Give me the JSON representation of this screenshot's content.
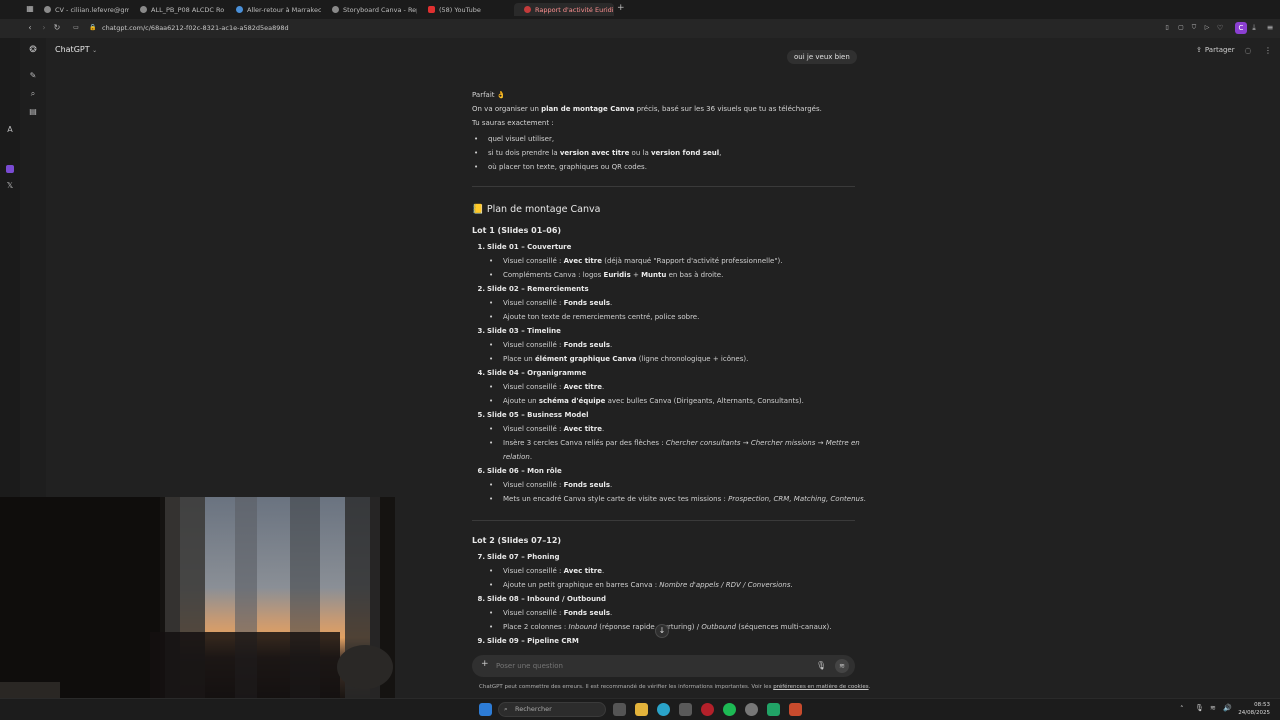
{
  "browser": {
    "tabs": [
      {
        "label": "CV - ciliian.lefevre@gm"
      },
      {
        "label": "ALL_PB_P08 ALCDC Ro"
      },
      {
        "label": "Aller-retour à Marrakech"
      },
      {
        "label": "Storyboard Canva - Rep"
      },
      {
        "label": "(58) YouTube"
      },
      {
        "label": "Rapport d'activité Euridis"
      }
    ],
    "new_tab": "+",
    "url": "chatgpt.com/c/68aa6212-f02c-8321-ac1e-a582d5ea898d"
  },
  "header": {
    "app_title": "ChatGPT",
    "share_label": "Partager"
  },
  "user_message": "oui je veux bien",
  "intro": {
    "parfait": "Parfait 👌",
    "line1_a": "On va organiser un ",
    "line1_b": "plan de montage Canva",
    "line1_c": " précis, basé sur les 36 visuels que tu as téléchargés.",
    "line2": "Tu sauras exactement :",
    "bullets": [
      {
        "a": "quel visuel utiliser,",
        "b": "",
        "c": "",
        "d": "",
        "e": ""
      },
      {
        "a": "si tu dois prendre la ",
        "b": "version avec titre",
        "c": " ou la ",
        "d": "version fond seul",
        "e": ","
      },
      {
        "a": "où placer ton texte, graphiques ou QR codes.",
        "b": "",
        "c": "",
        "d": "",
        "e": ""
      }
    ]
  },
  "plan_title": "📒 Plan de montage Canva",
  "lot1": {
    "title": "Lot 1 (Slides 01–06)",
    "slides": [
      {
        "num": "1.",
        "title": "Slide 01 – Couverture"
      },
      {
        "num": "2.",
        "title": "Slide 02 – Remerciements"
      },
      {
        "num": "3.",
        "title": "Slide 03 – Timeline"
      },
      {
        "num": "4.",
        "title": "Slide 04 – Organigramme"
      },
      {
        "num": "5.",
        "title": "Slide 05 – Business Model"
      },
      {
        "num": "6.",
        "title": "Slide 06 – Mon rôle"
      }
    ],
    "bullets": {
      "s1a_pre": "Visuel conseillé : ",
      "s1a_b": "Avec titre",
      "s1a_post": " (déjà marqué \"Rapport d'activité professionnelle\").",
      "s1b_pre": "Compléments Canva : logos ",
      "s1b_b1": "Euridis",
      "s1b_mid": " + ",
      "s1b_b2": "Muntu",
      "s1b_post": " en bas à droite.",
      "s2a_pre": "Visuel conseillé : ",
      "s2a_b": "Fonds seuls",
      "s2a_post": ".",
      "s2b": "Ajoute ton texte de remerciements centré, police sobre.",
      "s3a_pre": "Visuel conseillé : ",
      "s3a_b": "Fonds seuls",
      "s3a_post": ".",
      "s3b_pre": "Place un ",
      "s3b_b": "élément graphique Canva",
      "s3b_post": " (ligne chronologique + icônes).",
      "s4a_pre": "Visuel conseillé : ",
      "s4a_b": "Avec titre",
      "s4a_post": ".",
      "s4b_pre": "Ajoute un ",
      "s4b_b": "schéma d'équipe",
      "s4b_post": " avec bulles Canva (Dirigeants, Alternants, Consultants).",
      "s5a_pre": "Visuel conseillé : ",
      "s5a_b": "Avec titre",
      "s5a_post": ".",
      "s5b_pre": "Insère 3 cercles Canva reliés par des flèches : ",
      "s5b_i": "Chercher consultants → Chercher missions → Mettre en",
      "s5b_i2": "relation",
      "s5b_post": ".",
      "s6a_pre": "Visuel conseillé : ",
      "s6a_b": "Fonds seuls",
      "s6a_post": ".",
      "s6b_pre": "Mets un encadré Canva style carte de visite avec tes missions : ",
      "s6b_i": "Prospection, CRM, Matching, Contenus",
      "s6b_post": "."
    }
  },
  "lot2": {
    "title": "Lot 2 (Slides 07–12)",
    "slides": [
      {
        "num": "7.",
        "title": "Slide 07 – Phoning"
      },
      {
        "num": "8.",
        "title": "Slide 08 – Inbound / Outbound"
      },
      {
        "num": "9.",
        "title": "Slide 09 – Pipeline CRM"
      }
    ],
    "bullets": {
      "s7a_pre": "Visuel conseillé : ",
      "s7a_b": "Avec titre",
      "s7a_post": ".",
      "s7b_pre": "Ajoute un petit graphique en barres Canva : ",
      "s7b_i": "Nombre d'appels / RDV / Conversions",
      "s7b_post": ".",
      "s8a_pre": "Visuel conseillé : ",
      "s8a_b": "Fonds seuls",
      "s8a_post": ".",
      "s8b_pre": "Place 2 colonnes : ",
      "s8b_i1": "Inbound",
      "s8b_mid": " (réponse rapide, nurturing) / ",
      "s8b_i2": "Outbound",
      "s8b_post": " (séquences multi-canaux)."
    }
  },
  "composer": {
    "placeholder": "Poser une question",
    "plus": "+"
  },
  "footer_note": {
    "text": "ChatGPT peut commettre des erreurs. Il est recommandé de vérifier les informations importantes. Voir les ",
    "link": "préférences en matière de cookies",
    "end": "."
  },
  "taskbar": {
    "search_placeholder": "Rechercher",
    "time": "08:53",
    "date": "24/08/2025"
  },
  "colors": {
    "bg": "#212121",
    "accent_red": "#c43b3b",
    "text": "#d4d4d4"
  }
}
